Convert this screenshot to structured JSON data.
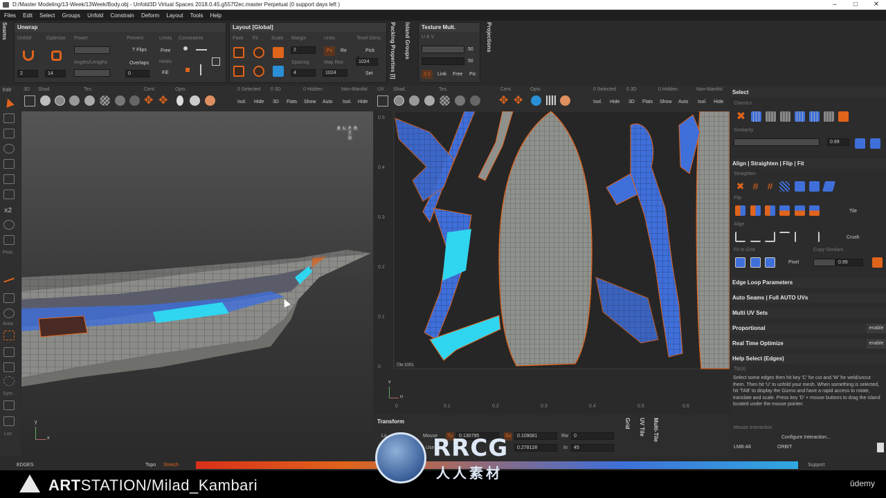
{
  "window": {
    "title": "D:/Master Modeling/13-Week/13Week/Body.obj - Unfold3D  Virtual Spaces 2018.0.45.g557f2ec.master Perpetual  (0 support days left )"
  },
  "menu": [
    "Files",
    "Edit",
    "Select",
    "Groups",
    "Unfold",
    "Constrain",
    "Deform",
    "Layout",
    "Tools",
    "Help"
  ],
  "top_tabs": {
    "seams": "Seams",
    "packing_properties": "Packing Properties [I]",
    "island_groups": "Island Groups",
    "projections": "Projections"
  },
  "unwrap": {
    "title": "Unwrap",
    "labels": {
      "unfold": "Unfold",
      "optimize": "Optimize",
      "power": "Power",
      "prevent": "Prevent",
      "limits": "Limits",
      "constraints": "Constraints",
      "angles_lengths": "Angles/Lengths",
      "holes": "Holes"
    },
    "unfold_value": "2",
    "optimize_value": "14",
    "t_flips": "T Flips",
    "overlaps": "Overlaps",
    "overlaps_value": "0",
    "free": "Free",
    "fill": "Fill"
  },
  "layout": {
    "title": "Layout [Global]",
    "labels": {
      "pack": "Pack",
      "fit": "Fit",
      "scale": "Scale",
      "margin": "Margin",
      "units": "Units",
      "texel_dens": "Texel Dens.",
      "spacing": "Spacing",
      "map_rez": "Map Rez"
    },
    "margin_value": "2",
    "spacing_value": "4",
    "units_value": "1024",
    "map_rez_value": "1024",
    "px": "Px",
    "re": "Re",
    "pick": "Pick",
    "set": "Set"
  },
  "texture_mult": {
    "title": "Texture Mult.",
    "uv_label": "U & V",
    "u_value": "50",
    "v_value": "50",
    "btn_1to1": "1:1",
    "link": "Link",
    "free": "Free",
    "pic": "Pic"
  },
  "left_toolbar": {
    "edit": "Edit",
    "x2": "x2",
    "prim": "Prim.",
    "area": "Area",
    "sym": "Sym.",
    "loc": "Loc"
  },
  "viewport3d": {
    "toolbar_labels": {
      "view": "3D",
      "shad": "Shad.",
      "tex": "Tex.",
      "cent": "Cent.",
      "opts": "Opts"
    },
    "selected": "0 Selected",
    "label_3d": "0 3D",
    "hidden": "0 Hidden",
    "non_manifold": "Non-Manifol",
    "buttons": [
      "Isol.",
      "Hide",
      "3D",
      "Flats",
      "Show",
      "Auto",
      "Isol.",
      "Hide"
    ],
    "viewcube_letters": [
      "B",
      "L",
      "F",
      "R",
      "T",
      "D"
    ],
    "axis_x": "x",
    "axis_y": "y"
  },
  "uv_viewport": {
    "toolbar_labels": {
      "view": "UV",
      "shad": "Shad.",
      "tex": "Tex.",
      "cent": "Cent.",
      "opts": "Opts"
    },
    "selected": "0 Selected",
    "label_3d": "0 3D",
    "hidden": "0 Hidden",
    "non_manifold": "Non-Manifol",
    "buttons": [
      "Isol.",
      "Hide",
      "3D",
      "Flats",
      "Show",
      "Auto",
      "Isol.",
      "Hide"
    ],
    "y_ticks": [
      "0.5",
      "0.4",
      "0.3",
      "0.2",
      "0.1",
      "0"
    ],
    "x_ticks": [
      "0",
      "0.1",
      "0.2",
      "0.3",
      "0.4",
      "0.5",
      "0.6"
    ],
    "tile_label": "Tile 1001",
    "axis_u": "u",
    "axis_v": "v"
  },
  "select_panel": {
    "title": "Select",
    "classics": "Classics",
    "similarity": "Similarity",
    "similarity_value": "0.99",
    "align_title": "Align | Straighten | Flip | Fit",
    "straighten": "Straighten",
    "flip": "Flip",
    "tile": "Tile",
    "align": "Align",
    "crush": "Crush",
    "fit_to_grid": "Fit to Grid",
    "copy_similars": "Copy Similars",
    "pixel": "Pixel",
    "copy_value": "0.99",
    "edge_loop": "Edge Loop Parameters",
    "auto_seams": "Auto Seams | Full AUTO UVs",
    "multi_uv": "Multi UV Sets",
    "proportional": "Proportional",
    "real_time": "Real Time Optimize",
    "enable": "enable",
    "help_title": "Help Select (Edges)",
    "tips": "Tip(s)",
    "help_text": "Select some edges then hit key 'C' for cut and 'W' for weld/uncut them. Then hit 'U' to unfold your mesh. When something is selected, hit 'TAB' to display the Gizmo and have a rapid access to rotate, translate and scale. Press key 'D' + mouse buttons to drag the island located under the mouse pointer.",
    "mouse_interaction": "Mouse Interaction",
    "configure": "Configure Interaction...",
    "lmb_alt": "LMB-Alt",
    "orbit": "ORBIT"
  },
  "transform": {
    "title": "Transform",
    "lo": "Lo",
    "mouse": "Mouse",
    "use": "Use",
    "tu": "Tu",
    "tu_value": "0.130795",
    "su": "Su",
    "su_value": "0.109081",
    "rw": "Rw",
    "rw_value": "0",
    "sv_value": "0.278128",
    "in": "In",
    "in_value": "45",
    "tabs": [
      "Grid",
      "UV Tile",
      "Multi-Tile"
    ]
  },
  "status": {
    "mode": "EDGES",
    "topo": "Topo",
    "stretch": "Stretch",
    "support": "Support"
  },
  "footer": {
    "artstation_prefix": "ART",
    "artstation_rest": "STATION/Milad_Kambari",
    "watermark_main": "RRCG",
    "watermark_sub": "人人素材",
    "udemy": "ūdemy"
  },
  "colors": {
    "accent_orange": "#e0641c",
    "selection_blue": "#3f6fd9",
    "highlight_cyan": "#30d5f0",
    "mesh_gray": "#8f918d"
  }
}
